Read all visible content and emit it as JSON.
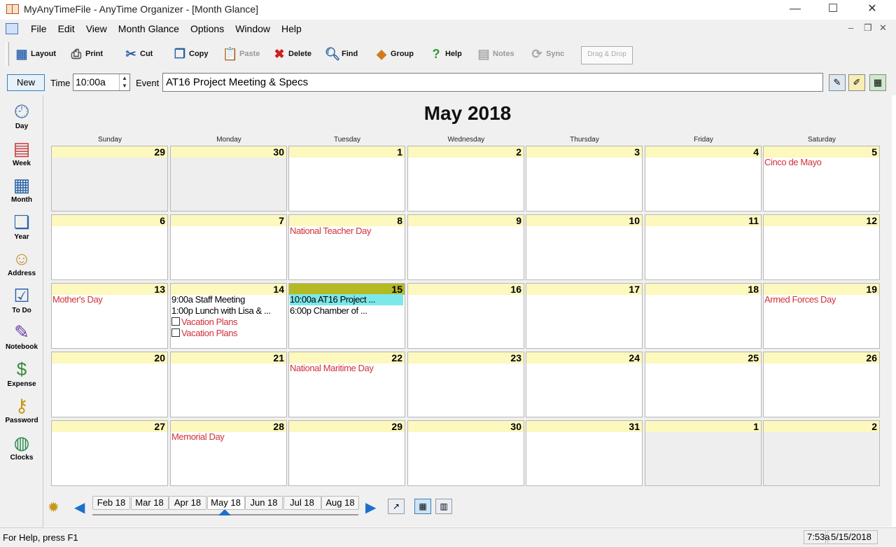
{
  "window": {
    "title": "MyAnyTimeFile - AnyTime Organizer - [Month Glance]",
    "minimize": "—",
    "maximize": "☐",
    "close": "✕"
  },
  "menu": {
    "items": [
      "File",
      "Edit",
      "View",
      "Month Glance",
      "Options",
      "Window",
      "Help"
    ],
    "mdi_min": "–",
    "mdi_restore": "❐",
    "mdi_close": "✕"
  },
  "toolbar": {
    "layout": "Layout",
    "print": "Print",
    "cut": "Cut",
    "copy": "Copy",
    "paste": "Paste",
    "delete": "Delete",
    "find": "Find",
    "group": "Group",
    "help": "Help",
    "notes": "Notes",
    "sync": "Sync",
    "dragdrop": "Drag & Drop"
  },
  "eventrow": {
    "new_label": "New",
    "time_label": "Time",
    "time_value": "10:00a",
    "event_label": "Event",
    "event_value": "AT16 Project Meeting & Specs"
  },
  "sidebar": {
    "items": [
      {
        "label": "Day",
        "icon": "clock-calendar-icon"
      },
      {
        "label": "Week",
        "icon": "week-calendar-icon"
      },
      {
        "label": "Month",
        "icon": "month-calendar-icon"
      },
      {
        "label": "Year",
        "icon": "year-calendar-icon"
      },
      {
        "label": "Address",
        "icon": "address-book-icon"
      },
      {
        "label": "To Do",
        "icon": "todo-list-icon"
      },
      {
        "label": "Notebook",
        "icon": "notebook-icon"
      },
      {
        "label": "Expense",
        "icon": "money-icon"
      },
      {
        "label": "Password",
        "icon": "key-icon"
      },
      {
        "label": "Clocks",
        "icon": "globe-clock-icon"
      }
    ]
  },
  "calendar": {
    "title": "May 2018",
    "days_of_week": [
      "Sunday",
      "Monday",
      "Tuesday",
      "Wednesday",
      "Thursday",
      "Friday",
      "Saturday"
    ],
    "weeks": [
      [
        {
          "day": "29",
          "other": true,
          "events": []
        },
        {
          "day": "30",
          "other": true,
          "events": []
        },
        {
          "day": "1",
          "events": []
        },
        {
          "day": "2",
          "events": []
        },
        {
          "day": "3",
          "events": []
        },
        {
          "day": "4",
          "events": []
        },
        {
          "day": "5",
          "events": [
            {
              "text": "Cinco de Mayo",
              "kind": "holiday"
            }
          ]
        }
      ],
      [
        {
          "day": "6",
          "events": []
        },
        {
          "day": "7",
          "events": []
        },
        {
          "day": "8",
          "events": [
            {
              "text": "National Teacher Day",
              "kind": "holiday"
            }
          ]
        },
        {
          "day": "9",
          "events": []
        },
        {
          "day": "10",
          "events": []
        },
        {
          "day": "11",
          "events": []
        },
        {
          "day": "12",
          "events": []
        }
      ],
      [
        {
          "day": "13",
          "events": [
            {
              "text": "Mother's Day",
              "kind": "holiday"
            }
          ]
        },
        {
          "day": "14",
          "events": [
            {
              "text": "9:00a Staff Meeting",
              "kind": "appt"
            },
            {
              "text": "1:00p Lunch with Lisa & ...",
              "kind": "appt"
            },
            {
              "text": "Vacation Plans",
              "kind": "todo"
            },
            {
              "text": "Vacation Plans",
              "kind": "todo"
            }
          ]
        },
        {
          "day": "15",
          "today": true,
          "events": [
            {
              "text": "10:00a AT16 Project ...",
              "kind": "selected"
            },
            {
              "text": "6:00p Chamber of ...",
              "kind": "appt"
            }
          ]
        },
        {
          "day": "16",
          "events": []
        },
        {
          "day": "17",
          "events": []
        },
        {
          "day": "18",
          "events": []
        },
        {
          "day": "19",
          "events": [
            {
              "text": "Armed Forces Day",
              "kind": "holiday"
            }
          ]
        }
      ],
      [
        {
          "day": "20",
          "events": []
        },
        {
          "day": "21",
          "events": []
        },
        {
          "day": "22",
          "events": [
            {
              "text": "National Maritime Day",
              "kind": "holiday"
            }
          ]
        },
        {
          "day": "23",
          "events": []
        },
        {
          "day": "24",
          "events": []
        },
        {
          "day": "25",
          "events": []
        },
        {
          "day": "26",
          "events": []
        }
      ],
      [
        {
          "day": "27",
          "events": []
        },
        {
          "day": "28",
          "events": [
            {
              "text": "Memorial Day",
              "kind": "holiday"
            }
          ]
        },
        {
          "day": "29",
          "events": []
        },
        {
          "day": "30",
          "events": []
        },
        {
          "day": "31",
          "events": []
        },
        {
          "day": "1",
          "other": true,
          "events": []
        },
        {
          "day": "2",
          "other": true,
          "events": []
        }
      ]
    ],
    "colors": {
      "holiday": "#d0303c",
      "header": "#fcf8be",
      "today_header": "#b5b924",
      "selected_event": "#7ce8ea"
    }
  },
  "nav": {
    "months": [
      "Feb 18",
      "Mar 18",
      "Apr 18",
      "May 18",
      "Jun 18",
      "Jul 18",
      "Aug 18"
    ],
    "active_month": "May 18"
  },
  "status": {
    "help": "For Help, press F1",
    "time": "7:53a",
    "date": "5/15/2018"
  }
}
